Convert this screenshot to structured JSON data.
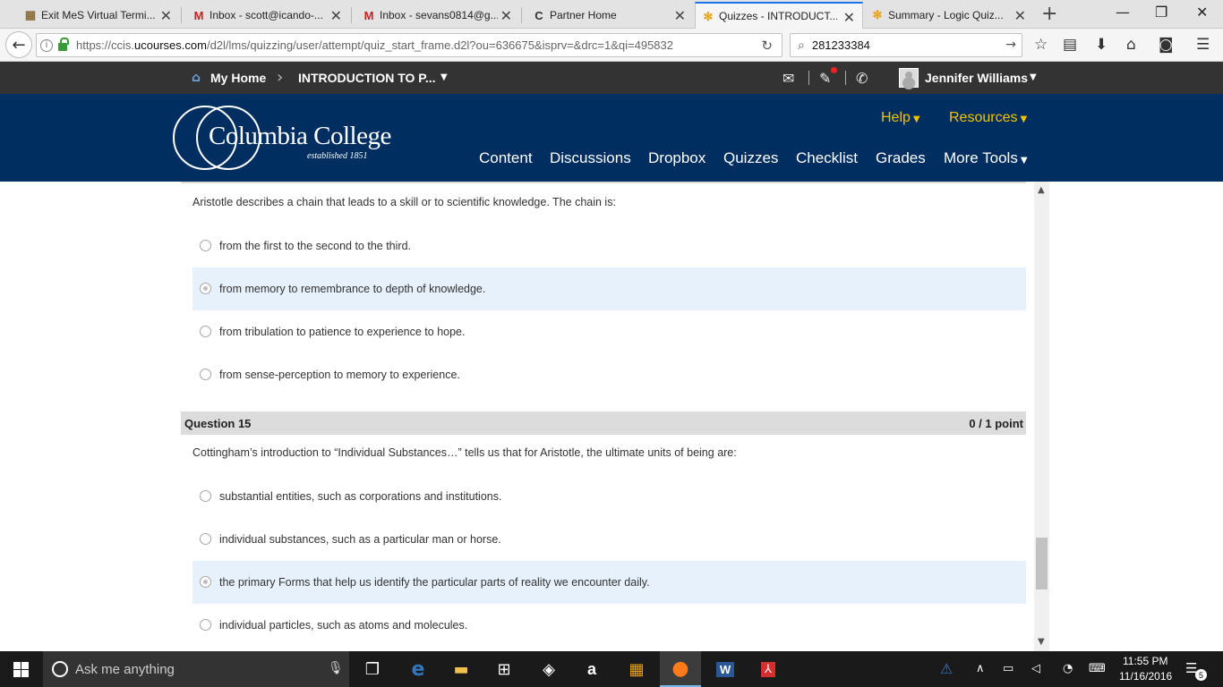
{
  "browser": {
    "tabs": [
      {
        "title": "Exit MeS Virtual Termi...",
        "icon": "virtual-terminal-icon"
      },
      {
        "title": "Inbox - scott@icando-...",
        "icon": "gmail-icon"
      },
      {
        "title": "Inbox - sevans0814@g...",
        "icon": "gmail-icon"
      },
      {
        "title": "Partner Home",
        "icon": "partner-c-icon"
      },
      {
        "title": "Quizzes - INTRODUCT...",
        "icon": "d2l-star-icon"
      },
      {
        "title": "Summary - Logic Quiz...",
        "icon": "d2l-star-icon"
      }
    ],
    "url_prefix": "https://ccis.",
    "url_domain": "ucourses.com",
    "url_rest": "/d2l/lms/quizzing/user/attempt/quiz_start_frame.d2l?ou=636675&isprv=&drc=1&qi=495832",
    "search_value": "281233384"
  },
  "minibar": {
    "home_label": "My Home",
    "course_label": "INTRODUCTION TO P...",
    "user_name": "Jennifer Williams"
  },
  "brand": {
    "logo_name": "Columbia College",
    "logo_tagline": "established 1851",
    "utility_links": [
      "Help",
      "Resources"
    ],
    "nav_links": [
      "Content",
      "Discussions",
      "Dropbox",
      "Quizzes",
      "Checklist",
      "Grades",
      "More Tools"
    ]
  },
  "quiz": {
    "q14": {
      "prompt": "Aristotle describes a chain that leads to a skill or to scientific knowledge. The chain is:",
      "options": [
        "from the first to the second to the third.",
        "from memory to remembrance to depth of knowledge.",
        "from tribulation to patience to experience to hope.",
        "from sense-perception to memory to experience."
      ],
      "selected_index": 1
    },
    "q15": {
      "title": "Question 15",
      "points": "0 / 1 point",
      "prompt": "Cottingham’s introduction to “Individual Substances…” tells us that for Aristotle, the ultimate units of being are:",
      "options": [
        "substantial entities, such as corporations and institutions.",
        "individual substances, such as a particular man or horse.",
        "the primary Forms that help us identify the particular parts of reality we encounter daily.",
        "individual particles, such as atoms and molecules."
      ],
      "selected_index": 2
    }
  },
  "taskbar": {
    "search_placeholder": "Ask me anything",
    "time": "11:55 PM",
    "date": "11/16/2016",
    "notification_count": "5"
  },
  "colors": {
    "brand_navy": "#012e61",
    "brand_gold": "#f4c300",
    "minibar_bg": "#333333",
    "selected_option_bg": "#e6f1fc"
  }
}
